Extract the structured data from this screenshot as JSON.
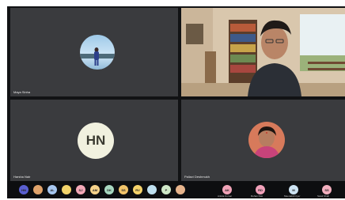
{
  "tiles": [
    {
      "name": "Maya Sinha"
    },
    {
      "name": ""
    },
    {
      "name": "Harsha Nair",
      "initials": "HN"
    },
    {
      "name": "Pallavi Deshmukh"
    }
  ],
  "colors": {
    "background": "#3a3b3e",
    "hn_avatar": "#f1f1df",
    "accent_pink": "#e8a2b8"
  },
  "bottom_bar": {
    "chips": [
      {
        "initials": "HN",
        "color": "#5a5fd0"
      },
      {
        "initials": "",
        "color": "#e0a36b"
      },
      {
        "initials": "AL",
        "color": "#a7c7f0"
      },
      {
        "initials": "",
        "color": "#f2d36a"
      },
      {
        "initials": "SJ",
        "color": "#f4a9b8"
      },
      {
        "initials": "AM",
        "color": "#f5d28a"
      },
      {
        "initials": "DK",
        "color": "#a8d8c0"
      },
      {
        "initials": "SS",
        "color": "#f2c46a"
      },
      {
        "initials": "RV",
        "color": "#f6d36b"
      },
      {
        "initials": "",
        "color": "#bfe0f0"
      },
      {
        "initials": "P",
        "color": "#cfe8c8"
      },
      {
        "initials": "",
        "color": "#e7b48c"
      }
    ],
    "right_chips": [
      {
        "initials": "AK",
        "color": "#f0a3b7",
        "name": "Ankita Kumar"
      },
      {
        "initials": "RD",
        "color": "#f2a1ba",
        "name": "Rohan Das"
      },
      {
        "initials": "M",
        "color": "#cde3f2",
        "name": "Meenakshi Iyer"
      },
      {
        "initials": "SS",
        "color": "#f3b0bf",
        "name": "Swati Shah"
      }
    ]
  }
}
